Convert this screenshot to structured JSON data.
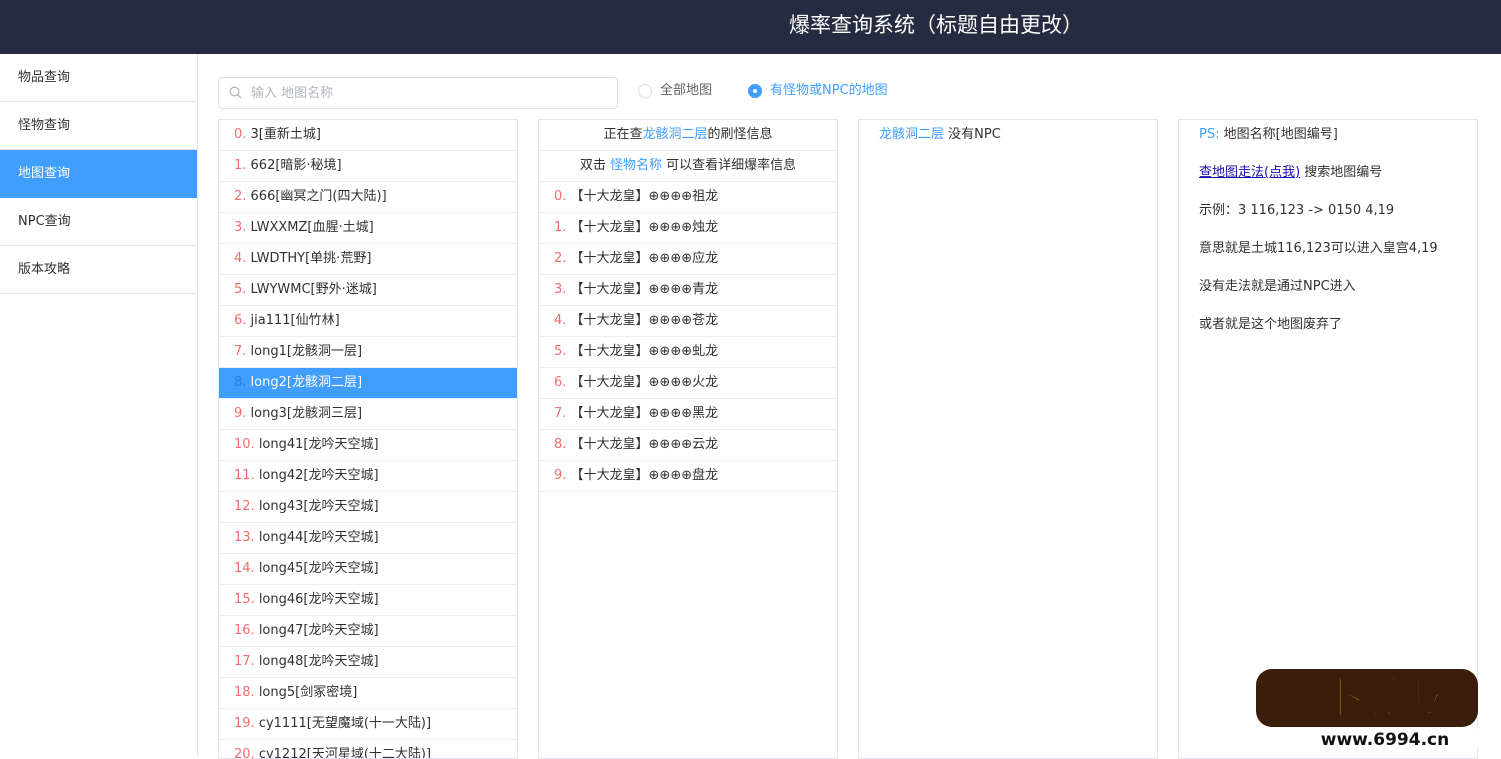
{
  "header": {
    "title": "爆率查询系统（标题自由更改）"
  },
  "sidebar": {
    "items": [
      {
        "label": "物品查询"
      },
      {
        "label": "怪物查询"
      },
      {
        "label": "地图查询"
      },
      {
        "label": "NPC查询"
      },
      {
        "label": "版本攻略"
      }
    ],
    "active_index": 2
  },
  "search": {
    "placeholder": "输入 地图名称",
    "value": ""
  },
  "filter": {
    "options": [
      "全部地图",
      "有怪物或NPC的地图"
    ],
    "selected_index": 1
  },
  "maps": [
    {
      "num": "0.",
      "text": " 3[重新土城]"
    },
    {
      "num": "1.",
      "text": " 662[暗影·秘境]"
    },
    {
      "num": "2.",
      "text": " 666[幽冥之门(四大陆)]"
    },
    {
      "num": "3.",
      "text": " LWXXMZ[血腥·土城]"
    },
    {
      "num": "4.",
      "text": " LWDTHY[单挑·荒野]"
    },
    {
      "num": "5.",
      "text": " LWYWMC[野外·迷城]"
    },
    {
      "num": "6.",
      "text": " jia111[仙竹林]"
    },
    {
      "num": "7.",
      "text": " long1[龙骸洞一层]"
    },
    {
      "num": "8.",
      "text": " long2[龙骸洞二层]"
    },
    {
      "num": "9.",
      "text": " long3[龙骸洞三层]"
    },
    {
      "num": "10.",
      "text": " long41[龙吟天空城]"
    },
    {
      "num": "11.",
      "text": " long42[龙吟天空城]"
    },
    {
      "num": "12.",
      "text": " long43[龙吟天空城]"
    },
    {
      "num": "13.",
      "text": " long44[龙吟天空城]"
    },
    {
      "num": "14.",
      "text": " long45[龙吟天空城]"
    },
    {
      "num": "15.",
      "text": " long46[龙吟天空城]"
    },
    {
      "num": "16.",
      "text": " long47[龙吟天空城]"
    },
    {
      "num": "17.",
      "text": " long48[龙吟天空城]"
    },
    {
      "num": "18.",
      "text": " long5[剑冢密境]"
    },
    {
      "num": "19.",
      "text": " cy1111[无望魔域(十一大陆)]"
    },
    {
      "num": "20.",
      "text": " cy1212[天河星域(十二大陆)]"
    }
  ],
  "selected_map_index": 8,
  "monster_panel": {
    "head_prefix": "正在查",
    "head_map": "龙骸洞二层",
    "head_suffix": "的刷怪信息",
    "hint_prefix": "双击 ",
    "hint_link": "怪物名称",
    "hint_suffix": " 可以查看详细爆率信息",
    "monsters": [
      {
        "num": "0.",
        "name": " 【十大龙皇】⊕⊕⊕⊕祖龙"
      },
      {
        "num": "1.",
        "name": " 【十大龙皇】⊕⊕⊕⊕烛龙"
      },
      {
        "num": "2.",
        "name": " 【十大龙皇】⊕⊕⊕⊕应龙"
      },
      {
        "num": "3.",
        "name": " 【十大龙皇】⊕⊕⊕⊕青龙"
      },
      {
        "num": "4.",
        "name": " 【十大龙皇】⊕⊕⊕⊕苍龙"
      },
      {
        "num": "5.",
        "name": " 【十大龙皇】⊕⊕⊕⊕虬龙"
      },
      {
        "num": "6.",
        "name": " 【十大龙皇】⊕⊕⊕⊕火龙"
      },
      {
        "num": "7.",
        "name": " 【十大龙皇】⊕⊕⊕⊕黑龙"
      },
      {
        "num": "8.",
        "name": " 【十大龙皇】⊕⊕⊕⊕云龙"
      },
      {
        "num": "9.",
        "name": " 【十大龙皇】⊕⊕⊕⊕盘龙"
      }
    ]
  },
  "npc_panel": {
    "map": "龙骸洞二层",
    "text": " 没有NPC"
  },
  "info_panel": {
    "ps_label": "PS:",
    "ps_text": " 地图名称[地图编号]",
    "link": "查地图走法(点我)",
    "link_suffix": " 搜索地图编号",
    "example": "示例：3 116,123 -> 0150 4,19",
    "meaning": "意思就是土城116,123可以进入皇宫4,19",
    "line4": "没有走法就是通过NPC进入",
    "line5": "或者就是这个地图废弃了"
  },
  "watermark": {
    "text": "萝卜论坛",
    "url": "www.6994.cn"
  },
  "colors": {
    "header_bg": "#252c41",
    "accent": "#409eff",
    "index_red": "#f56c6c"
  }
}
